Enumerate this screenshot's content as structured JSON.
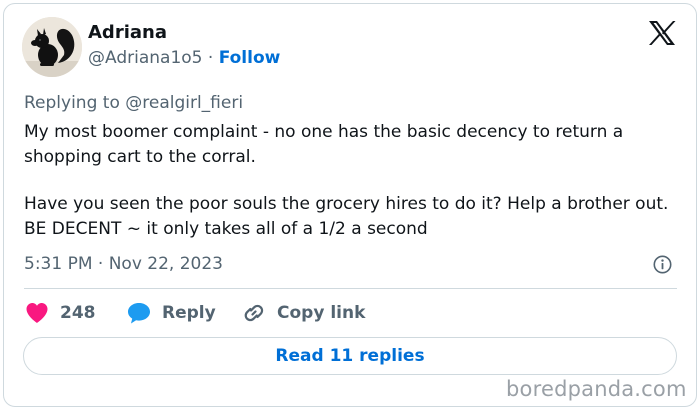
{
  "author": {
    "name": "Adriana",
    "handle": "@Adriana1o5",
    "separator": " · ",
    "follow_label": "Follow",
    "avatar_icon": "squirrel-avatar"
  },
  "platform_icon": "x-logo-icon",
  "reply_context": "Replying to @realgirl_fieri",
  "tweet": {
    "paragraph_1": "My most boomer complaint - no one has the basic decency to return a shopping cart to the corral.",
    "paragraph_2": "Have you seen the poor souls the grocery hires to do it?  Help a brother out. BE DECENT ~ it only takes all of a 1/2 a second"
  },
  "timestamp": "5:31 PM · Nov 22, 2023",
  "actions": {
    "like_count": "248",
    "reply_label": "Reply",
    "copy_link_label": "Copy link"
  },
  "replies_button_label": "Read 11 replies",
  "watermark": "boredpanda.com",
  "colors": {
    "link_blue": "#006fd6",
    "like_pink": "#f91880",
    "reply_blue": "#1d9bf0",
    "muted_text": "#536471",
    "border": "#cfd9de"
  }
}
